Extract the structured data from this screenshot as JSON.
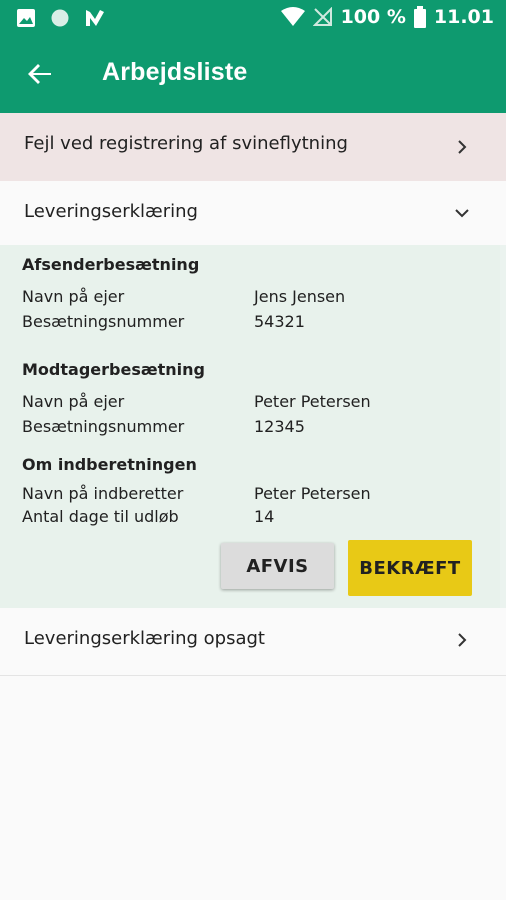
{
  "status_bar": {
    "battery": "100 %",
    "time": "11.01",
    "icons": [
      "image-icon",
      "circle-icon",
      "app-check-icon",
      "wifi-icon",
      "no-signal-icon",
      "battery-icon"
    ]
  },
  "app_bar": {
    "title": "Arbejdsliste",
    "back_icon": "arrow-back-icon"
  },
  "list": {
    "error_item": {
      "label": "Fejl ved registrering af svineflytning",
      "icon": "chevron-right-icon"
    },
    "delivery_item": {
      "label": "Leveringserklæring",
      "icon": "chevron-down-icon"
    },
    "cancelled_item": {
      "label": "Leveringserklæring opsagt",
      "icon": "chevron-right-icon"
    }
  },
  "details": {
    "sender": {
      "title": "Afsenderbesætning",
      "owner_key": "Navn på ejer",
      "owner_val": "Jens Jensen",
      "herd_key": "Besætningsnummer",
      "herd_val": "54321"
    },
    "receiver": {
      "title": "Modtagerbesætning",
      "owner_key": "Navn på ejer",
      "owner_val": "Peter Petersen",
      "herd_key": "Besætningsnummer",
      "herd_val": "12345"
    },
    "report": {
      "title": "Om indberetningen",
      "reporter_key": "Navn på indberetter",
      "reporter_val": "Peter Petersen",
      "days_key": "Antal dage til udløb",
      "days_val": "14"
    },
    "buttons": {
      "reject": "AFVIS",
      "confirm": "BEKRÆFT"
    }
  },
  "colors": {
    "primary": "#0e9a6f",
    "error_bg": "#efe4e4",
    "card_bg": "#e8f2ec",
    "confirm": "#e8c916"
  }
}
